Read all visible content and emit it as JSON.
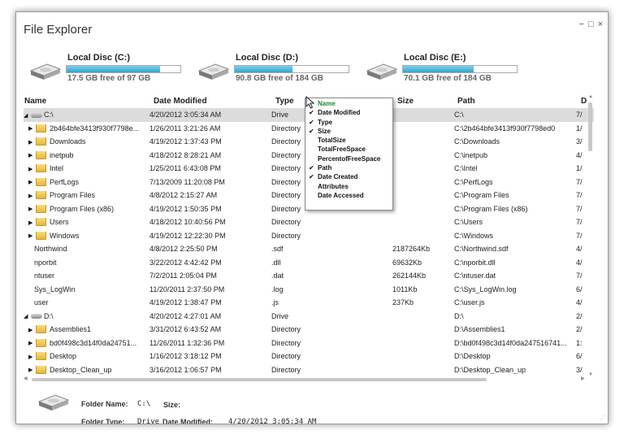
{
  "window": {
    "title": "File Explorer",
    "controls": [
      "−",
      "□",
      "×"
    ]
  },
  "drives": [
    {
      "name": "Local Disc (C:)",
      "free": "17.5 GB free of 97 GB",
      "used_fraction": 0.82
    },
    {
      "name": "Local Disc (D:)",
      "free": "90.8 GB free of 184 GB",
      "used_fraction": 0.51
    },
    {
      "name": "Local Disc (E:)",
      "free": "70.1 GB free of 184 GB",
      "used_fraction": 0.62
    }
  ],
  "grid": {
    "headers": [
      "Name",
      "Date Modified",
      "Type",
      "Size",
      "Path",
      "D"
    ],
    "rows": [
      {
        "kind": "drive",
        "expander": "◢",
        "name": "C:\\",
        "date": "4/20/2012 3:05:34 AM",
        "type": "Drive",
        "size": "",
        "path": "C:\\",
        "dc": "7/",
        "selected": true
      },
      {
        "kind": "folder",
        "expander": "▶",
        "name": "2b464bfe3413f930f7798e...",
        "date": "1/26/2011 3:21:26 AM",
        "type": "Directory",
        "size": "",
        "path": "C:\\2b464bfe3413f930f7798ed0",
        "dc": "1/"
      },
      {
        "kind": "folder",
        "expander": "▶",
        "name": "Downloads",
        "date": "4/19/2012 1:37:43 PM",
        "type": "Directory",
        "size": "",
        "path": "C:\\Downloads",
        "dc": "3/"
      },
      {
        "kind": "folder",
        "expander": "▶",
        "name": "inetpub",
        "date": "4/18/2012 8:28:21 AM",
        "type": "Directory",
        "size": "",
        "path": "C:\\inetpub",
        "dc": "4/"
      },
      {
        "kind": "folder",
        "expander": "▶",
        "name": "Intel",
        "date": "1/25/2011 6:43:08 PM",
        "type": "Directory",
        "size": "",
        "path": "C:\\Intel",
        "dc": "1/"
      },
      {
        "kind": "folder",
        "expander": "▶",
        "name": "PerfLogs",
        "date": "7/13/2009 11:20:08 PM",
        "type": "Directory",
        "size": "",
        "path": "C:\\PerfLogs",
        "dc": "7/"
      },
      {
        "kind": "folder",
        "expander": "▶",
        "name": "Program Files",
        "date": "4/8/2012 2:15:27 AM",
        "type": "Directory",
        "size": "",
        "path": "C:\\Program Files",
        "dc": "7/"
      },
      {
        "kind": "folder",
        "expander": "▶",
        "name": "Program Files (x86)",
        "date": "4/19/2012 1:50:35 PM",
        "type": "Directory",
        "size": "",
        "path": "C:\\Program Files (x86)",
        "dc": "7/"
      },
      {
        "kind": "folder",
        "expander": "▶",
        "name": "Users",
        "date": "4/18/2012 10:40:56 PM",
        "type": "Directory",
        "size": "",
        "path": "C:\\Users",
        "dc": "7/"
      },
      {
        "kind": "folder",
        "expander": "▶",
        "name": "Windows",
        "date": "4/19/2012 12:22:30 PM",
        "type": "Directory",
        "size": "",
        "path": "C:\\Windows",
        "dc": "7/"
      },
      {
        "kind": "file",
        "expander": "",
        "name": "Northwind",
        "date": "4/8/2012 2:25:50 PM",
        "type": ".sdf",
        "size": "2187264Kb",
        "path": "C:\\Northwind.sdf",
        "dc": "4/"
      },
      {
        "kind": "file",
        "expander": "",
        "name": "nporbit",
        "date": "3/22/2012 4:42:42 PM",
        "type": ".dll",
        "size": "69632Kb",
        "path": "C:\\nporbit.dll",
        "dc": "4/"
      },
      {
        "kind": "file",
        "expander": "",
        "name": "ntuser",
        "date": "7/2/2011 2:05:04 PM",
        "type": ".dat",
        "size": "262144Kb",
        "path": "C:\\ntuser.dat",
        "dc": "7/"
      },
      {
        "kind": "file",
        "expander": "",
        "name": "Sys_LogWin",
        "date": "11/20/2011 2:37:50 PM",
        "type": ".log",
        "size": "1011Kb",
        "path": "C:\\Sys_LogWin.log",
        "dc": "6/"
      },
      {
        "kind": "file",
        "expander": "",
        "name": "user",
        "date": "4/19/2012 1:38:47 PM",
        "type": ".js",
        "size": "237Kb",
        "path": "C:\\user.js",
        "dc": "4/"
      },
      {
        "kind": "drive",
        "expander": "◢",
        "name": "D:\\",
        "date": "4/20/2012 4:27:01 AM",
        "type": "Drive",
        "size": "",
        "path": "D:\\",
        "dc": "2/"
      },
      {
        "kind": "folder",
        "expander": "▶",
        "name": "Assemblies1",
        "date": "3/31/2012 6:43:52 AM",
        "type": "Directory",
        "size": "",
        "path": "D:\\Assemblies1",
        "dc": "2/"
      },
      {
        "kind": "folder",
        "expander": "▶",
        "name": "bd0f498c3d14f0da24751...",
        "date": "11/26/2011 1:32:36 PM",
        "type": "Directory",
        "size": "",
        "path": "D:\\bd0f498c3d14f0da247516741...",
        "dc": "1:"
      },
      {
        "kind": "folder",
        "expander": "▶",
        "name": "Desktop",
        "date": "1/16/2012 3:18:12 PM",
        "type": "Directory",
        "size": "",
        "path": "D:\\Desktop",
        "dc": "6/"
      },
      {
        "kind": "folder",
        "expander": "▶",
        "name": "Desktop_Clean_up",
        "date": "3/16/2012 1:06:57 PM",
        "type": "Directory",
        "size": "",
        "path": "D:\\Desktop_Clean_up",
        "dc": "3/"
      }
    ]
  },
  "column_menu": {
    "items": [
      {
        "label": "Name",
        "checked": false,
        "highlight": true
      },
      {
        "label": "Date Modified",
        "checked": true,
        "highlight": false
      },
      {
        "label": "Type",
        "checked": true,
        "highlight": false
      },
      {
        "label": "Size",
        "checked": true,
        "highlight": false
      },
      {
        "label": "TotalSize",
        "checked": false,
        "highlight": false
      },
      {
        "label": "TotalFreeSpace",
        "checked": false,
        "highlight": false
      },
      {
        "label": "PercentofFreeSpace",
        "checked": false,
        "highlight": false
      },
      {
        "label": "Path",
        "checked": true,
        "highlight": false
      },
      {
        "label": "Date Created",
        "checked": true,
        "highlight": false
      },
      {
        "label": "Attributes",
        "checked": false,
        "highlight": false
      },
      {
        "label": "Date Accessed",
        "checked": false,
        "highlight": false
      }
    ],
    "check_glyph": "✔"
  },
  "details": {
    "folder_name_label": "Folder Name:",
    "folder_name": "C:\\",
    "size_label": "Size:",
    "size": "",
    "folder_type_label": "Folder Type:",
    "folder_type": "Drive",
    "date_modified_label": "Date Modified:",
    "date_modified": "4/20/2012 3:05:34 AM"
  },
  "colors": {
    "accent": "#2fa8cf",
    "menu_highlight": "#1c8a2e",
    "selection": "#dcdcdc"
  }
}
